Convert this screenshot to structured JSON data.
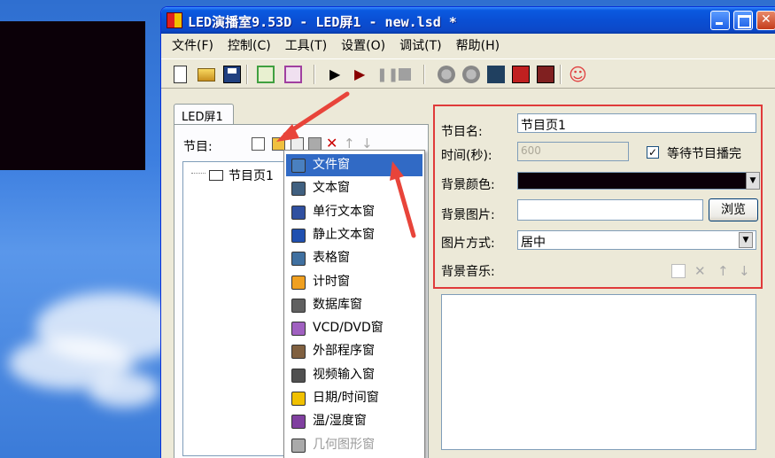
{
  "window": {
    "title": "LED演播室9.53D - LED屏1 - new.lsd *"
  },
  "menu": [
    "文件(F)",
    "控制(C)",
    "工具(T)",
    "设置(O)",
    "调试(T)",
    "帮助(H)"
  ],
  "toolbar_icons": [
    "new-icon",
    "open-icon",
    "save-icon",
    "green-grid-icon",
    "edit-icon",
    "play-icon",
    "step-icon",
    "pause-icon",
    "stop-icon",
    "person-icon",
    "person-icon",
    "network-icon",
    "red-screen-icon",
    "red-screen-icon",
    "smiley-icon"
  ],
  "left": {
    "tab": "LED屏1",
    "program_label": "节目:",
    "tree_item": "节目页1"
  },
  "context_menu": [
    {
      "label": "文件窗",
      "icon": "person-card-icon",
      "selected": true,
      "disabled": false
    },
    {
      "label": "文本窗",
      "icon": "text-window-icon",
      "selected": false,
      "disabled": false
    },
    {
      "label": "单行文本窗",
      "icon": "single-line-text-icon",
      "selected": false,
      "disabled": false
    },
    {
      "label": "静止文本窗",
      "icon": "static-text-icon",
      "selected": false,
      "disabled": false
    },
    {
      "label": "表格窗",
      "icon": "table-icon",
      "selected": false,
      "disabled": false
    },
    {
      "label": "计时窗",
      "icon": "timer-icon",
      "selected": false,
      "disabled": false
    },
    {
      "label": "数据库窗",
      "icon": "database-icon",
      "selected": false,
      "disabled": false
    },
    {
      "label": "VCD/DVD窗",
      "icon": "dvd-icon",
      "selected": false,
      "disabled": false
    },
    {
      "label": "外部程序窗",
      "icon": "gear-icon",
      "selected": false,
      "disabled": false
    },
    {
      "label": "视频输入窗",
      "icon": "video-input-icon",
      "selected": false,
      "disabled": false
    },
    {
      "label": "日期/时间窗",
      "icon": "clock-icon",
      "selected": false,
      "disabled": false
    },
    {
      "label": "温/湿度窗",
      "icon": "thermometer-icon",
      "selected": false,
      "disabled": false
    },
    {
      "label": "几何图形窗",
      "icon": "geometry-icon",
      "selected": false,
      "disabled": true
    }
  ],
  "right": {
    "name_label": "节目名:",
    "name_value": "节目页1",
    "time_label": "时间(秒):",
    "time_value": "600",
    "wait_label": "等待节目播完",
    "wait_checked": "✓",
    "bg_color_label": "背景颜色:",
    "bg_color": "#0b0008",
    "bg_image_label": "背景图片:",
    "browse_label": "浏览",
    "image_mode_label": "图片方式:",
    "image_mode_value": "居中",
    "music_label": "背景音乐:"
  },
  "colors": {
    "highlight": "#e03a3a",
    "selection": "#316ac5"
  }
}
